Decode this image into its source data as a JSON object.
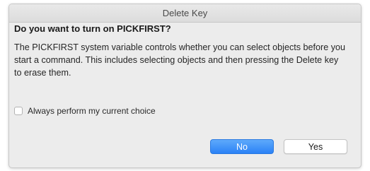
{
  "dialog": {
    "title": "Delete Key",
    "heading": "Do you want to turn on PICKFIRST?",
    "message": "The PICKFIRST system variable controls whether you can select objects before you start a command. This includes selecting objects and then pressing the Delete key to erase them.",
    "checkbox_label": "Always perform my current choice",
    "checkbox_checked": false,
    "buttons": {
      "no_label": "No",
      "yes_label": "Yes"
    },
    "colors": {
      "default_button": "#2b82f6",
      "window_background": "#ececec"
    }
  }
}
